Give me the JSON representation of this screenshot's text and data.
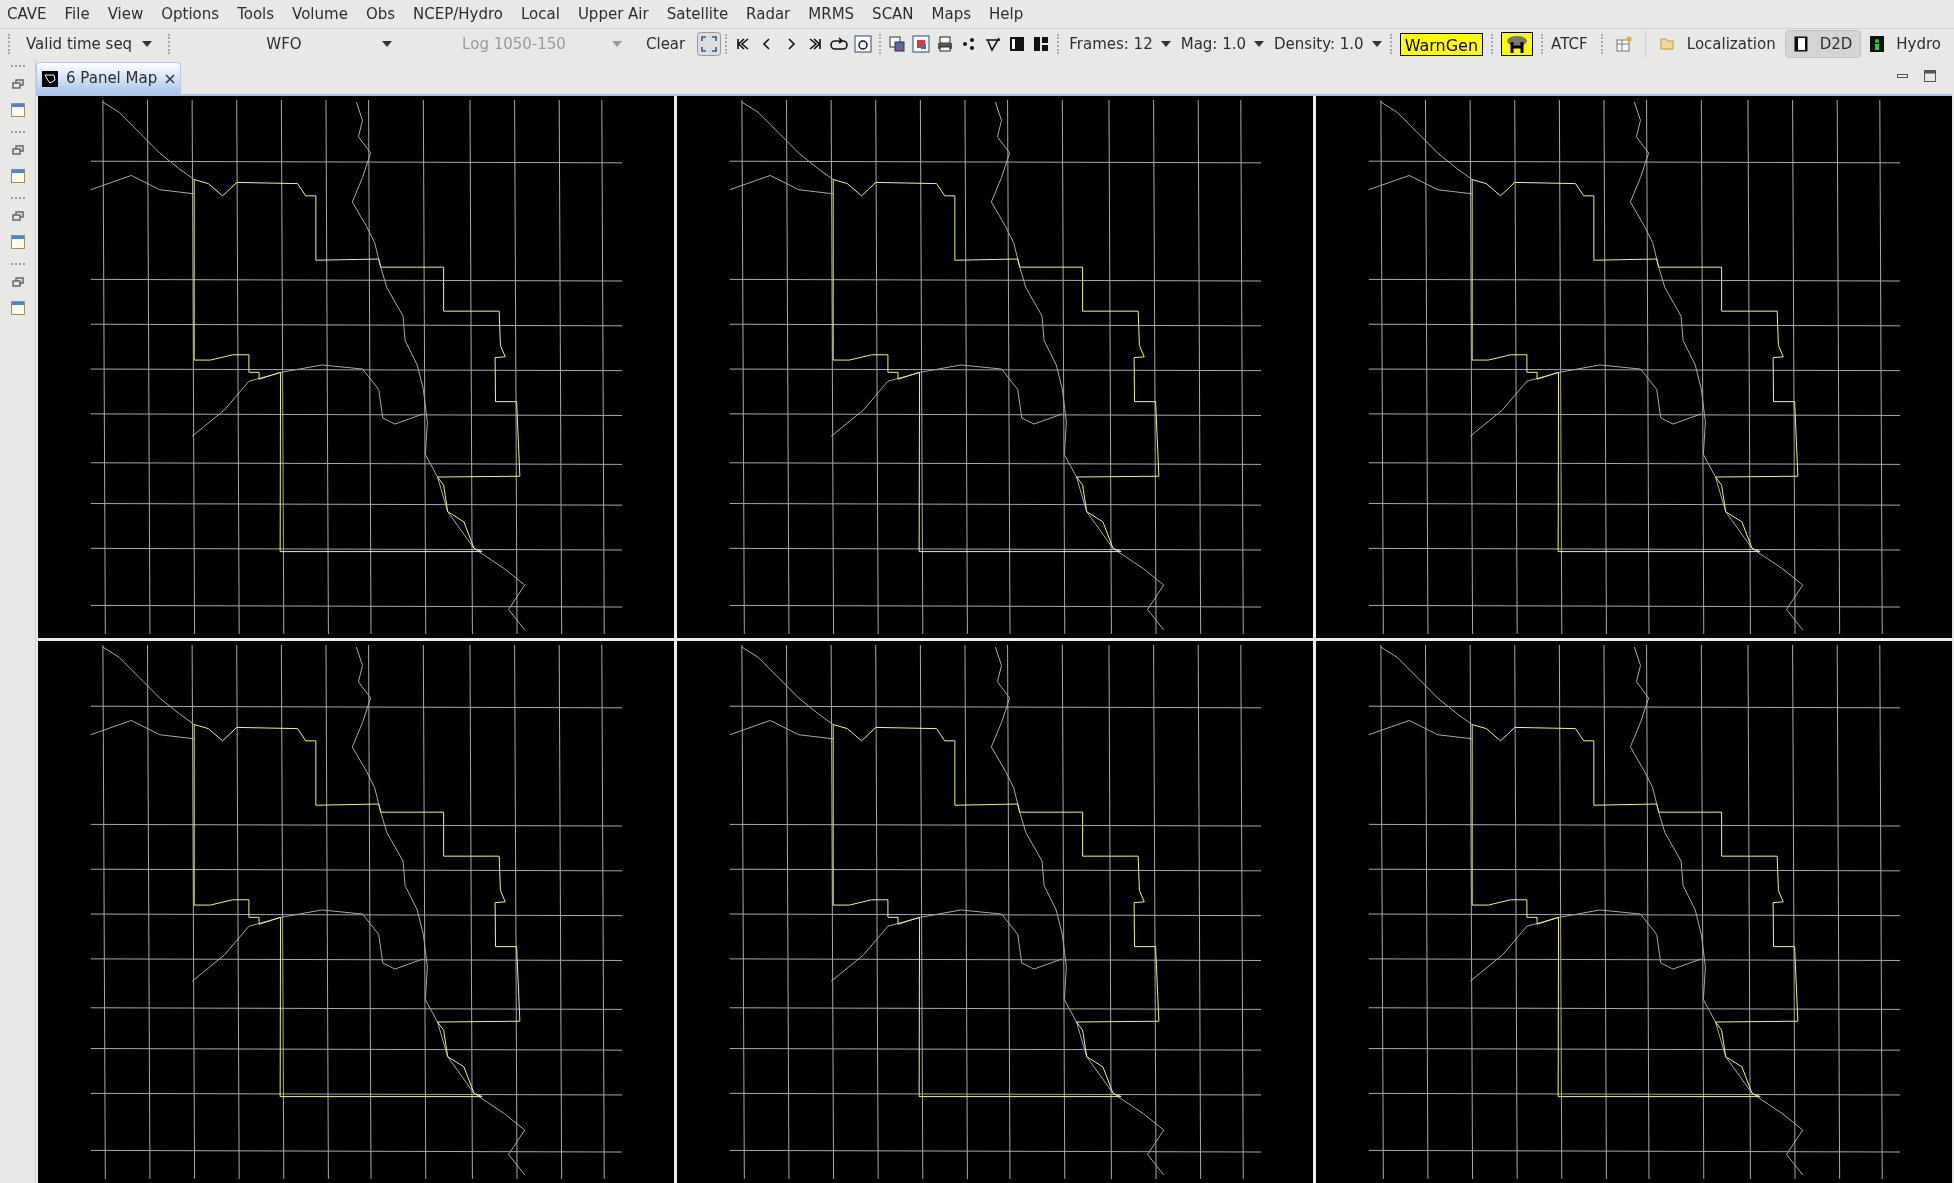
{
  "menu": [
    "CAVE",
    "File",
    "View",
    "Options",
    "Tools",
    "Volume",
    "Obs",
    "NCEP/Hydro",
    "Local",
    "Upper Air",
    "Satellite",
    "Radar",
    "MRMS",
    "SCAN",
    "Maps",
    "Help"
  ],
  "toolbar": {
    "dropdowns": [
      {
        "value": "Valid time seq",
        "disabled": false
      },
      {
        "value": "WFO",
        "disabled": false
      },
      {
        "value": "Log 1050-150",
        "disabled": true
      }
    ],
    "clear_button": "Clear",
    "settings": [
      {
        "label": "Frames: 12"
      },
      {
        "label": "Mag: 1.0"
      },
      {
        "label": "Density: 1.0"
      }
    ],
    "warngen_button": "WarnGen",
    "atcf_button": "ATCF",
    "perspectives": [
      {
        "label": "Localization",
        "selected": false,
        "kind": "folder"
      },
      {
        "label": "D2D",
        "selected": true,
        "kind": "film"
      },
      {
        "label": "Hydro",
        "selected": false,
        "kind": "hydro"
      }
    ]
  },
  "tabs": [
    {
      "label": "6 Panel Map",
      "selected": true
    }
  ],
  "panels": [
    {
      "kind": "county_map"
    },
    {
      "kind": "county_map"
    },
    {
      "kind": "county_map"
    },
    {
      "kind": "county_map"
    },
    {
      "kind": "county_map"
    },
    {
      "kind": "county_map"
    }
  ]
}
